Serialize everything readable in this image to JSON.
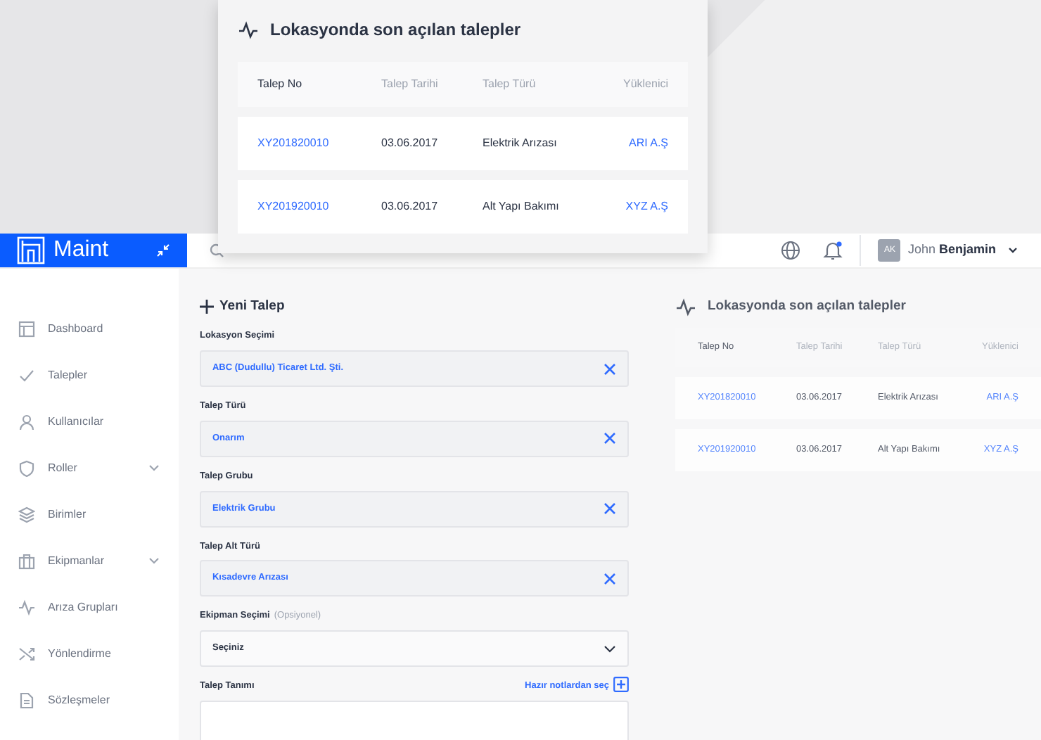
{
  "popup": {
    "title": "Lokasyonda son açılan talepler",
    "columns": [
      "Talep No",
      "Talep Tarihi",
      "Talep Türü",
      "Yüklenici"
    ],
    "rows": [
      {
        "no": "XY201820010",
        "date": "03.06.2017",
        "type": "Elektrik Arızası",
        "contractor": "ARI A.Ş"
      },
      {
        "no": "XY201920010",
        "date": "03.06.2017",
        "type": "Alt Yapı Bakımı",
        "contractor": "XYZ A.Ş"
      }
    ]
  },
  "brand": "Maint",
  "header": {
    "notification": true,
    "user": {
      "initials": "AK",
      "first_name": "John",
      "last_name": "Benjamin"
    }
  },
  "sidebar": {
    "items": [
      {
        "label": "Dashboard",
        "expandable": false
      },
      {
        "label": "Talepler",
        "expandable": false
      },
      {
        "label": "Kullanıcılar",
        "expandable": false
      },
      {
        "label": "Roller",
        "expandable": true
      },
      {
        "label": "Birimler",
        "expandable": false
      },
      {
        "label": "Ekipmanlar",
        "expandable": true
      },
      {
        "label": "Arıza Grupları",
        "expandable": false
      },
      {
        "label": "Yönlendirme",
        "expandable": false
      },
      {
        "label": "Sözleşmeler",
        "expandable": false
      }
    ]
  },
  "form": {
    "title": "Yeni Talep",
    "fields": [
      {
        "kind": "choice",
        "label": "Lokasyon Seçimi",
        "value": "ABC (Dudullu) Ticaret Ltd. Şti."
      },
      {
        "kind": "choice",
        "label": "Talep Türü",
        "value": "Onarım"
      },
      {
        "kind": "choice",
        "label": "Talep Grubu",
        "value": "Elektrik Grubu"
      },
      {
        "kind": "choice",
        "label": "Talep Alt Türü",
        "value": "Kısadevre Arızası"
      },
      {
        "kind": "select",
        "label": "Ekipman Seçimi",
        "hint": "(Opsiyonel)",
        "value": "Seçiniz"
      },
      {
        "kind": "textarea",
        "label": "Talep Tanımı",
        "action": "Hazır notlardan seç"
      }
    ]
  },
  "side_panel": {
    "title": "Lokasyonda son açılan talepler",
    "columns": [
      "Talep No",
      "Talep Tarihi",
      "Talep Türü",
      "Yüklenici"
    ],
    "rows": [
      {
        "no": "XY201820010",
        "date": "03.06.2017",
        "type": "Elektrik Arızası",
        "contractor": "ARI A.Ş"
      },
      {
        "no": "XY201920010",
        "date": "03.06.2017",
        "type": "Alt Yapı Bakımı",
        "contractor": "XYZ A.Ş"
      }
    ]
  }
}
